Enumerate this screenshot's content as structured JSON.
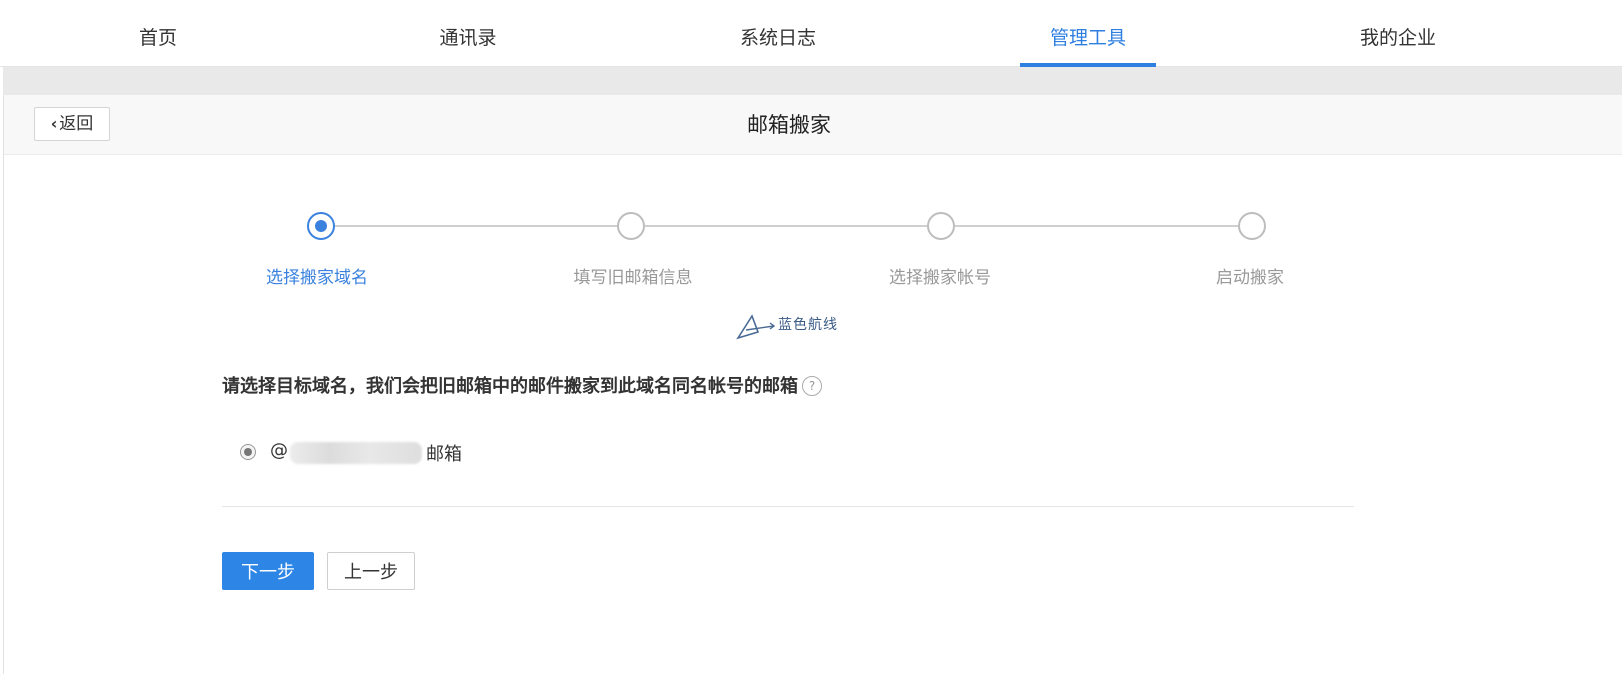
{
  "nav": {
    "items": [
      {
        "label": "首页"
      },
      {
        "label": "通讯录"
      },
      {
        "label": "系统日志"
      },
      {
        "label": "管理工具"
      },
      {
        "label": "我的企业"
      }
    ],
    "active": "管理工具"
  },
  "header": {
    "back_label": "返回",
    "title": "邮箱搬家"
  },
  "steps": [
    {
      "label": "选择搬家域名",
      "state": "active"
    },
    {
      "label": "填写旧邮箱信息",
      "state": "pending"
    },
    {
      "label": "选择搬家帐号",
      "state": "pending"
    },
    {
      "label": "启动搬家",
      "state": "pending"
    }
  ],
  "watermark": {
    "text": "蓝色航线"
  },
  "form": {
    "question": "请选择目标域名，我们会把旧邮箱中的邮件搬家到此域名同名帐号的邮箱",
    "help_icon": "question-circle-icon",
    "option": {
      "prefix": "@",
      "suffix": "邮箱",
      "selected": true
    }
  },
  "buttons": {
    "next": "下一步",
    "prev": "上一步"
  },
  "colors": {
    "accent": "#2d7fe0",
    "primary_button": "#2d86e6",
    "step_active": "#3a82de",
    "step_inactive": "#bdbdbd"
  }
}
